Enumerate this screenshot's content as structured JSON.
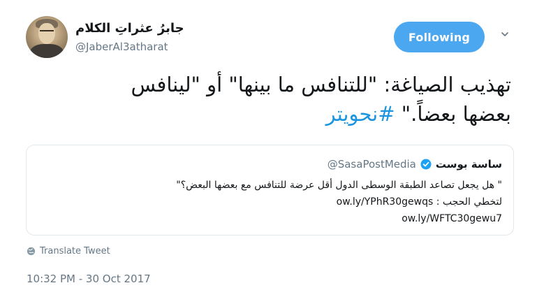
{
  "author": {
    "display_name": "جابرُ عثراتِ الكلام",
    "handle": "@JaberAl3atharat"
  },
  "follow_button": {
    "label": "Following"
  },
  "icons": {
    "caret": "chevron-down-icon",
    "verified": "verified-badge-icon",
    "globe": "globe-icon"
  },
  "colors": {
    "accent": "#4aa7f0",
    "link": "#1b95e0",
    "muted": "#657786"
  },
  "tweet": {
    "line1": "تهذيب الصياغة: \"للتنافس ما بينها\" أو \"لينافس",
    "line2_text": "بعضها بعضاً.\"",
    "hashtag": "#نحويتر"
  },
  "quoted_tweet": {
    "name": "ساسة بوست",
    "handle": "@SasaPostMedia",
    "line1": "\" هل يجعل تصاعد الطبقة الوسطى الدول أقل عرضة للتنافس مع بعضها البعض؟\"",
    "line2_text": "لتخطي الحجب :",
    "line2_link": "ow.ly/YPhR30gewqs",
    "line3_link": "ow.ly/WFTC30gewu7"
  },
  "translate_label": "Translate Tweet",
  "timestamp": "10:32 PM - 30 Oct 2017"
}
